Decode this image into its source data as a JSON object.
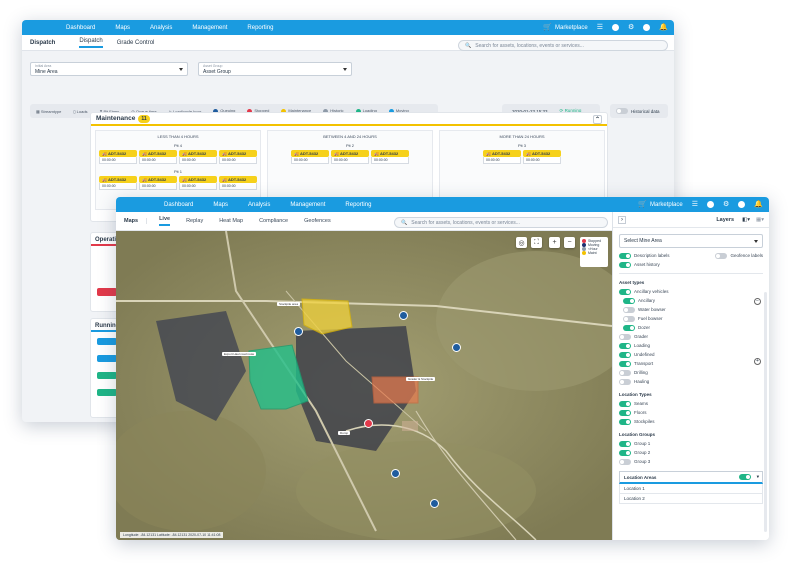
{
  "back": {
    "nav": [
      "Dashboard",
      "Maps",
      "Analysis",
      "Management",
      "Reporting"
    ],
    "marketplace": "Marketplace",
    "app_title": "Dispatch",
    "tabs": [
      "Dispatch",
      "Grade Control"
    ],
    "search_placeholder": "Search for assets, locations, events or services...",
    "filters": [
      {
        "caption": "Initial Area",
        "value": "Mine Area"
      },
      {
        "caption": "Asset Group",
        "value": "Asset Group"
      }
    ],
    "legend": [
      {
        "label": "Streamtype"
      },
      {
        "label": "Loads"
      },
      {
        "label": "Pit Firms"
      },
      {
        "label": "Queue time"
      },
      {
        "label": "Load/cycle hour"
      },
      {
        "label": "Queuing",
        "color": "#1f5c9e"
      },
      {
        "label": "Stopped",
        "color": "#e2394a"
      },
      {
        "label": "Maintenance",
        "color": "#f3c200"
      },
      {
        "label": "Historic",
        "color": "#8e9aa8"
      },
      {
        "label": "Loading",
        "color": "#1fb587"
      },
      {
        "label": "Moving",
        "color": "#1a9be0"
      }
    ],
    "datetime": "2020-01-23 15:33",
    "running": "Running",
    "historical": "Historical data",
    "maintenance": {
      "title": "Maintenance",
      "count": "11",
      "columns": [
        {
          "title": "LESS THAN 4 HOURS",
          "groups": [
            {
              "pit": "Pit 4",
              "trucks": [
                "ADT-5432",
                "ADT-5432",
                "ADT-5432",
                "ADT-5432"
              ]
            },
            {
              "pit": "Pit 1",
              "trucks": [
                "ADT-5432",
                "ADT-5432",
                "ADT-5432",
                "ADT-5432"
              ]
            }
          ]
        },
        {
          "title": "BETWEEN 4 AND 24 HOURS",
          "groups": [
            {
              "pit": "Pit 2",
              "trucks": [
                "ADT-5432",
                "ADT-5432",
                "ADT-5432"
              ]
            }
          ]
        },
        {
          "title": "MORE THAN 24 HOURS",
          "groups": [
            {
              "pit": "Pit 3",
              "trucks": [
                "ADT-5432",
                "ADT-5432"
              ]
            }
          ]
        }
      ],
      "time": "00:00:00"
    },
    "operations_label": "Operati",
    "running_label": "Running"
  },
  "front": {
    "nav": [
      "Dashboard",
      "Maps",
      "Analysis",
      "Management",
      "Reporting"
    ],
    "marketplace": "Marketplace",
    "app_title": "Maps",
    "tabs": [
      "Live",
      "Replay",
      "Heat Map",
      "Compliance",
      "Geofences"
    ],
    "search_placeholder": "Search for assets, locations, events or services...",
    "map_legend": [
      {
        "label": "Stopped",
        "color": "#e2394a"
      },
      {
        "label": "Moving",
        "color": "#1f2f6e"
      },
      {
        "label": "<Hour",
        "color": "#8e9aa8"
      },
      {
        "label": "Maint",
        "color": "#f3c200"
      }
    ],
    "map_labels": [
      "Stockpile area",
      "Export Haul road route",
      "Grader & Stockpile",
      "Dump"
    ],
    "footer": "Longitude: -84.12131  Latitude: -84.12131  2020-07-10 11:41:08",
    "layers": "Layers",
    "mine_area": "Select Mine Area",
    "description_labels": "Description labels",
    "geofence_labels": "Geofence labels",
    "asset_history": "Asset history",
    "asset_types_title": "Asset types",
    "asset_types": [
      {
        "label": "Ancillary vehicles",
        "on": true
      },
      {
        "label": "Ancillary",
        "on": true
      },
      {
        "label": "Water bowser",
        "on": false
      },
      {
        "label": "Fuel bowser",
        "on": false
      },
      {
        "label": "Dozer",
        "on": true
      },
      {
        "label": "Grader",
        "on": false
      },
      {
        "label": "Loading",
        "on": true
      },
      {
        "label": "Undefined",
        "on": true
      },
      {
        "label": "Transport",
        "on": true
      },
      {
        "label": "Drilling",
        "on": false
      },
      {
        "label": "Hauling",
        "on": false
      }
    ],
    "location_types_title": "Location Types",
    "location_types": [
      {
        "label": "Seams",
        "on": true
      },
      {
        "label": "Floors",
        "on": true
      },
      {
        "label": "Stockpiles",
        "on": true
      }
    ],
    "location_groups_title": "Location Groups",
    "location_groups": [
      {
        "label": "Group 1",
        "on": true
      },
      {
        "label": "Group 2",
        "on": true
      },
      {
        "label": "Group 3",
        "on": false
      }
    ],
    "location_areas_title": "Location Areas",
    "location_areas": [
      "Location 1",
      "Location 2"
    ]
  }
}
